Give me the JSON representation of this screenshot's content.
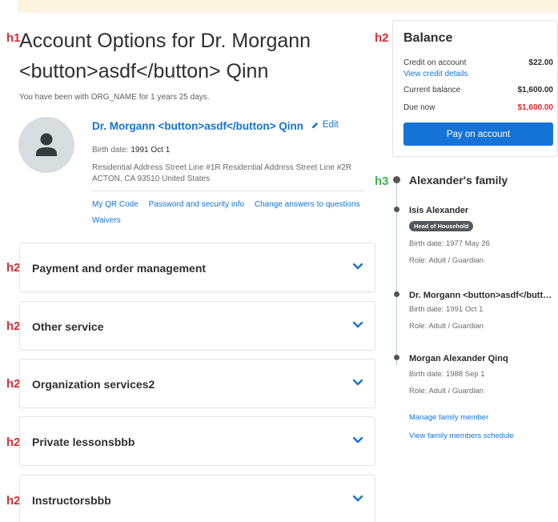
{
  "colors": {
    "accent": "#1573d8",
    "danger": "#e8262d",
    "tag_h1_h2": "#e8262d",
    "tag_h3": "#3ab54a",
    "banner": "#fdf4e1"
  },
  "heading_tags": {
    "h1": "h1",
    "h2": "h2",
    "h3": "h3"
  },
  "page": {
    "title": "Account Options for Dr. Morgann <button>asdf</button> Qinn",
    "tenure": "You have been with ORG_NAME for 1 years 25 days."
  },
  "profile": {
    "avatar_icon": "person-icon",
    "name": "Dr. Morgann <button>asdf</button> Qinn",
    "edit_label": "Edit",
    "edit_icon": "pencil-icon",
    "birth_label": "Birth date:",
    "birth_value": "1991 Oct 1",
    "address_line1": "Residential Address Street Line #1R Residential Address Street Line #2R",
    "address_line2": "ACTON, CA 93510 United States",
    "links": [
      "My QR Code",
      "Password and security info",
      "Change answers to questions",
      "Waivers"
    ]
  },
  "accordions": [
    {
      "label": "Payment and order management"
    },
    {
      "label": "Other service"
    },
    {
      "label": "Organization services2"
    },
    {
      "label": "Private lessonsbbb"
    },
    {
      "label": "Instructorsbbb"
    }
  ],
  "balance": {
    "title": "Balance",
    "credit_label": "Credit on account",
    "credit_amount": "$22.00",
    "credit_link": "View credit details",
    "current_label": "Current balance",
    "current_amount": "$1,600.00",
    "due_label": "Due now",
    "due_amount": "$1,600.00",
    "pay_button": "Pay on account"
  },
  "family": {
    "title": "Alexander's family",
    "badge": "Head of Household",
    "members": [
      {
        "name": "Isis Alexander",
        "birth_label": "Birth date:",
        "birth": "1977 May 26",
        "role_label": "Role:",
        "role": "Adult / Guardian"
      },
      {
        "name": "Dr. Morgann <button>asdf</button> Qinn",
        "birth_label": "Birth date:",
        "birth": "1991 Oct 1",
        "role_label": "Role:",
        "role": "Adult / Guardian"
      },
      {
        "name": "Morgan Alexander Qinq",
        "birth_label": "Birth date:",
        "birth": "1988 Sep 1",
        "role_label": "Role:",
        "role": "Adult / Guardian"
      }
    ],
    "manage_link": "Manage family member",
    "schedule_link": "View family members schedule"
  }
}
